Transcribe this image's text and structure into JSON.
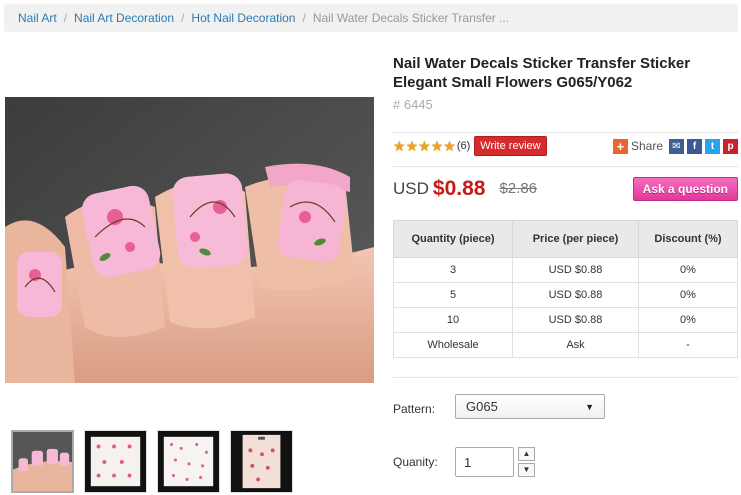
{
  "breadcrumb": {
    "items": [
      "Nail Art",
      "Nail Art Decoration",
      "Hot Nail Decoration"
    ],
    "current": "Nail Water Decals Sticker Transfer ...",
    "separator": "/"
  },
  "product": {
    "title": "Nail Water Decals Sticker Transfer Sticker Elegant Small Flowers G065/Y062",
    "sku": "# 6445"
  },
  "rating": {
    "stars": 5,
    "review_count": "(6)",
    "write_review_label": "Write review"
  },
  "share": {
    "label": "Share",
    "icons": [
      "plus-icon",
      "mail-icon",
      "facebook-icon",
      "twitter-icon",
      "pinterest-icon"
    ]
  },
  "price": {
    "currency": "USD",
    "current": "$0.88",
    "original": "$2.86",
    "ask_label": "Ask a question"
  },
  "tiers": {
    "headers": [
      "Quantity (piece)",
      "Price (per piece)",
      "Discount (%)"
    ],
    "rows": [
      [
        "3",
        "USD $0.88",
        "0%"
      ],
      [
        "5",
        "USD $0.88",
        "0%"
      ],
      [
        "10",
        "USD $0.88",
        "0%"
      ],
      [
        "Wholesale",
        "Ask",
        "-"
      ]
    ]
  },
  "options": {
    "pattern_label": "Pattern:",
    "pattern_value": "G065",
    "quantity_label": "Quanity:",
    "quantity_value": "1"
  },
  "colors": {
    "link": "#2a7ab0",
    "price": "#c81818",
    "write_review": "#d62b2b",
    "ask_button": "#e0399b",
    "star": "#f0a21b"
  }
}
